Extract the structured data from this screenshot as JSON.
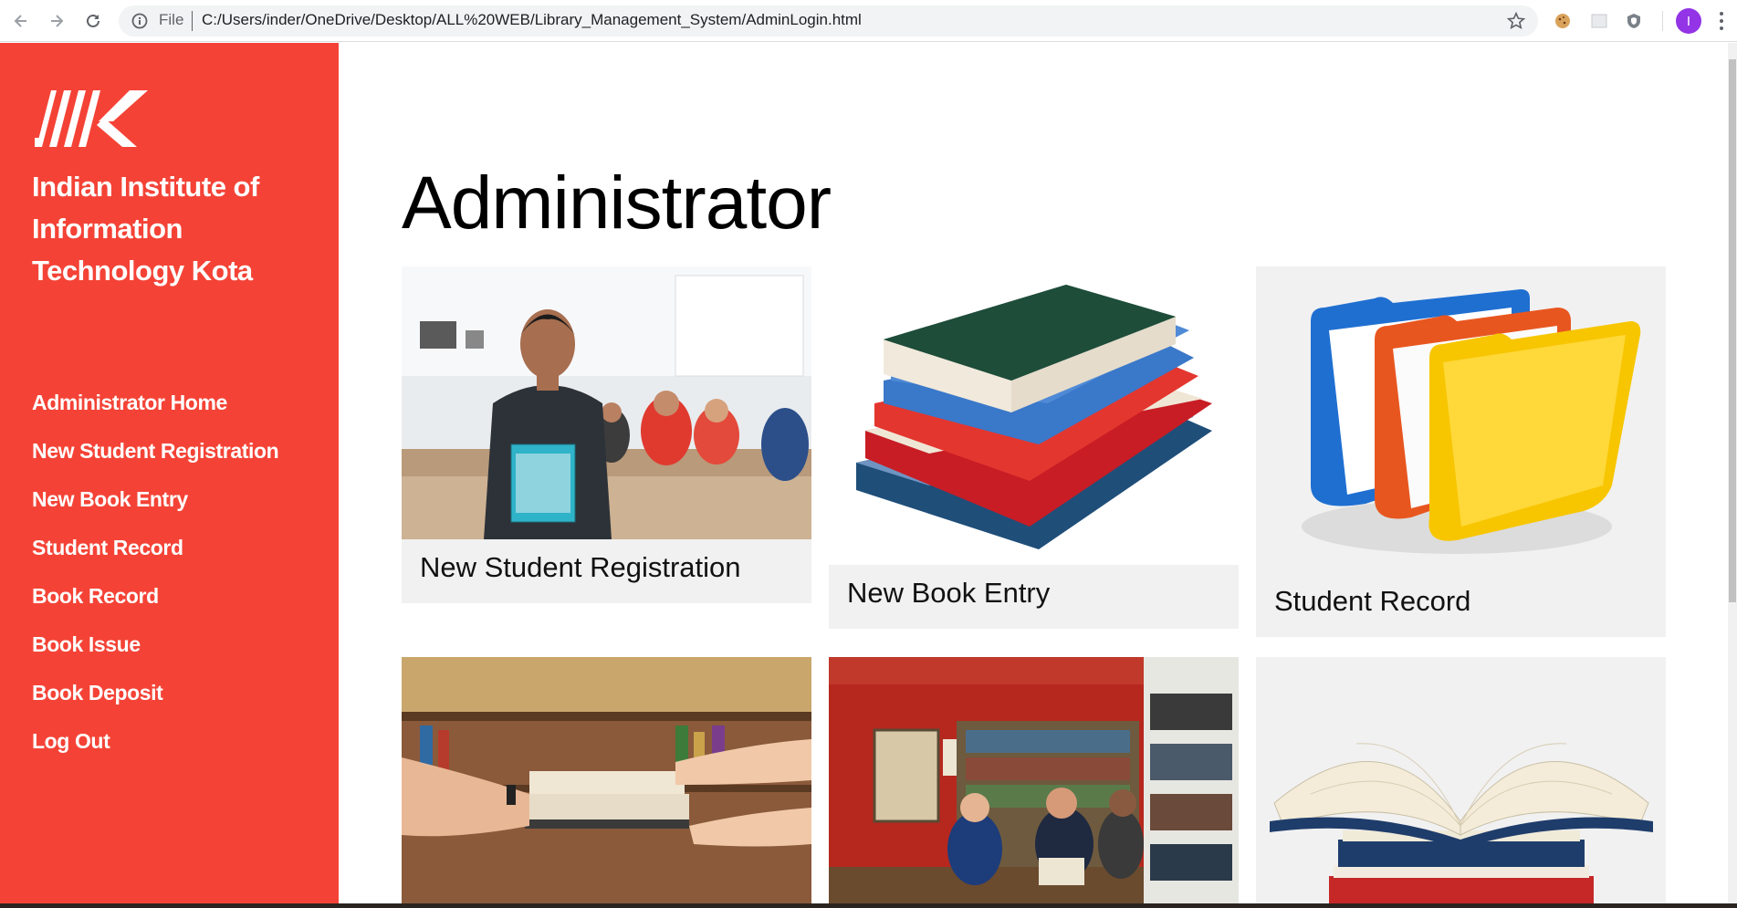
{
  "browser": {
    "file_label": "File",
    "url": "C:/Users/inder/OneDrive/Desktop/ALL%20WEB/Library_Management_System/AdminLogin.html",
    "profile_initial": "I",
    "profile_color": "#9334e6"
  },
  "sidebar": {
    "logo_icon": "iiitk-logo",
    "institute_name_lines": [
      "Indian Institute of",
      "Information",
      "Technology Kota"
    ],
    "accent_color": "#f44336",
    "links": [
      {
        "label": "Administrator Home"
      },
      {
        "label": "New Student Registration"
      },
      {
        "label": "New Book Entry"
      },
      {
        "label": "Student Record"
      },
      {
        "label": "Book Record"
      },
      {
        "label": "Book Issue"
      },
      {
        "label": "Book Deposit"
      },
      {
        "label": "Log Out"
      }
    ]
  },
  "main": {
    "title": "Administrator",
    "cards": [
      {
        "caption": "New Student Registration",
        "image": "student-photo"
      },
      {
        "caption": "New Book Entry",
        "image": "book-stack"
      },
      {
        "caption": "Student Record",
        "image": "folders"
      },
      {
        "caption": "",
        "image": "book-handover-photo"
      },
      {
        "caption": "",
        "image": "library-desk-photo"
      },
      {
        "caption": "",
        "image": "open-book"
      }
    ]
  }
}
